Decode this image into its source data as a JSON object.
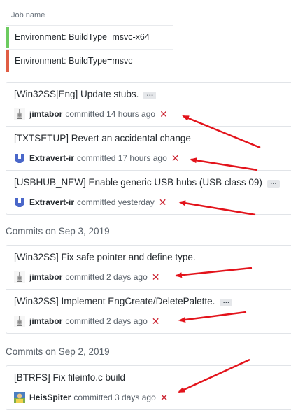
{
  "job_table": {
    "header": "Job name",
    "rows": [
      {
        "label": "Environment: BuildType=msvc-x64",
        "status_color": "#6ccb5f"
      },
      {
        "label": "Environment: BuildType=msvc",
        "status_color": "#e05d44"
      }
    ]
  },
  "commit_groups": [
    {
      "heading": "",
      "commits": [
        {
          "title": "[Win32SS|Eng] Update stubs.",
          "has_more": true,
          "author": "jimtabor",
          "committed_text": "committed 14 hours ago",
          "status": "failed"
        },
        {
          "title": "[TXTSETUP] Revert an accidental change",
          "has_more": false,
          "author": "Extravert-ir",
          "committed_text": "committed 17 hours ago",
          "status": "failed"
        },
        {
          "title": "[USBHUB_NEW] Enable generic USB hubs (USB class 09)",
          "has_more": true,
          "author": "Extravert-ir",
          "committed_text": "committed yesterday",
          "status": "failed"
        }
      ]
    },
    {
      "heading": "Commits on Sep 3, 2019",
      "commits": [
        {
          "title": "[Win32SS] Fix safe pointer and define type.",
          "has_more": false,
          "author": "jimtabor",
          "committed_text": "committed 2 days ago",
          "status": "failed"
        },
        {
          "title": "[Win32SS] Implement EngCreate/DeletePalette.",
          "has_more": true,
          "author": "jimtabor",
          "committed_text": "committed 2 days ago",
          "status": "failed"
        }
      ]
    },
    {
      "heading": "Commits on Sep 2, 2019",
      "commits": [
        {
          "title": "[BTRFS] Fix fileinfo.c build",
          "has_more": false,
          "author": "HeisSpiter",
          "committed_text": "committed 3 days ago",
          "status": "failed"
        }
      ]
    }
  ],
  "labels": {
    "more_button": "…",
    "fail_mark": "✕"
  },
  "colors": {
    "fail_red": "#cb2431",
    "annotation_arrow": "#e3131b",
    "pass_green": "#6ccb5f",
    "fail_orange_red": "#e05d44"
  }
}
